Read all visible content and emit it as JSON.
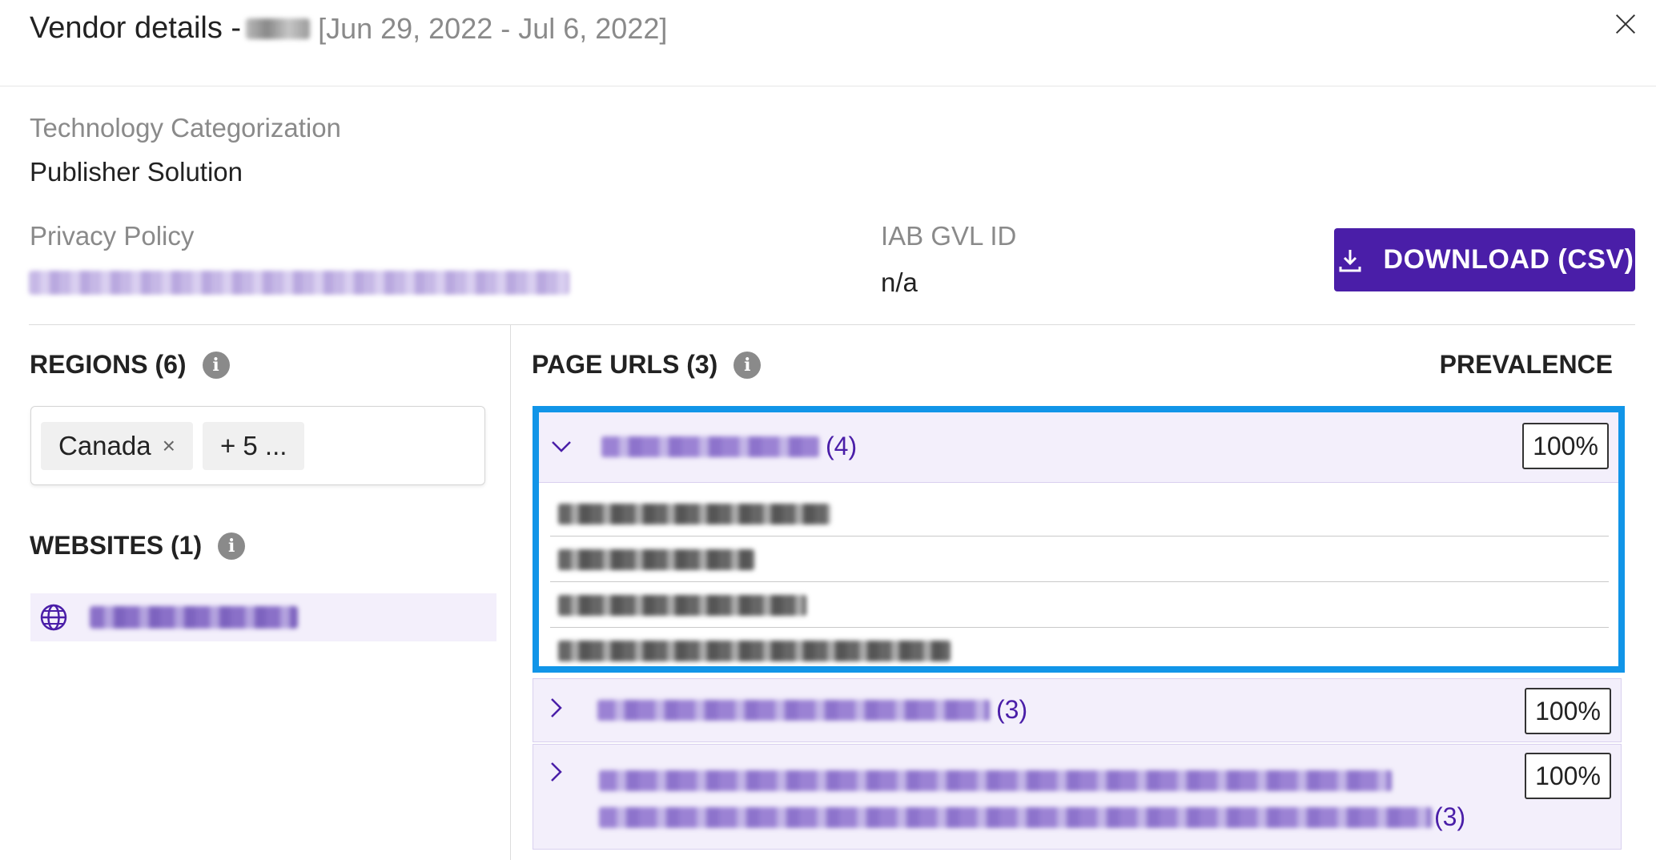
{
  "header": {
    "title_prefix": "Vendor details -",
    "date_range": "[Jun 29, 2022 - Jul 6, 2022]"
  },
  "details": {
    "tech_label": "Technology Categorization",
    "tech_value": "Publisher Solution",
    "privacy_label": "Privacy Policy",
    "iab_label": "IAB GVL ID",
    "iab_value": "n/a"
  },
  "actions": {
    "download_label": "DOWNLOAD (CSV)"
  },
  "regions": {
    "title": "REGIONS (6)",
    "chips": [
      "Canada",
      "+ 5 ..."
    ],
    "remove_glyph": "×"
  },
  "websites": {
    "title": "WEBSITES (1)"
  },
  "page_urls": {
    "title": "PAGE URLS (3)",
    "prevalence_title": "PREVALENCE",
    "rows": [
      {
        "count": "(4)",
        "prevalence": "100%",
        "expanded": true
      },
      {
        "count": "(3)",
        "prevalence": "100%",
        "expanded": false
      },
      {
        "count": "(3)",
        "prevalence": "100%",
        "expanded": false
      }
    ]
  },
  "icons": {
    "info": "i",
    "close": "close-icon",
    "download": "download-icon",
    "globe": "globe-icon",
    "chevron_down": "chevron-down-icon",
    "chevron_right": "chevron-right-icon"
  },
  "colors": {
    "primary": "#4a1ea8",
    "highlight": "#1195e8",
    "row_bg": "#f3effb"
  }
}
